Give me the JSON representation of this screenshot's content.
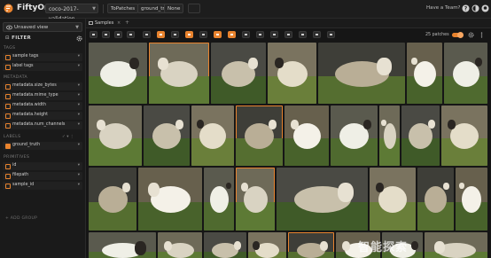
{
  "app": {
    "name": "FiftyOne",
    "dataset": "coco-2017-validation",
    "view_chips": [
      "ToPatches",
      "ground_truth",
      "None"
    ],
    "team_link": "Have a Team?"
  },
  "sidebar": {
    "view_select": "Unsaved view",
    "filter_label": "FILTER",
    "sections": [
      {
        "title": "TAGS",
        "fields": [
          {
            "label": "sample tags",
            "filled": false
          },
          {
            "label": "label tags",
            "filled": false
          }
        ]
      },
      {
        "title": "METADATA",
        "fields": [
          {
            "label": "metadata.size_bytes",
            "filled": false
          },
          {
            "label": "metadata.mime_type",
            "filled": false
          },
          {
            "label": "metadata.width",
            "filled": false
          },
          {
            "label": "metadata.height",
            "filled": false
          },
          {
            "label": "metadata.num_channels",
            "filled": false
          }
        ]
      },
      {
        "title": "LABELS",
        "fields": [
          {
            "label": "ground_truth",
            "filled": true
          }
        ]
      },
      {
        "title": "PRIMITIVES",
        "fields": [
          {
            "label": "id",
            "filled": false
          },
          {
            "label": "filepath",
            "filled": false
          },
          {
            "label": "sample_id",
            "filled": false
          }
        ]
      }
    ],
    "add_group": "+ ADD GROUP"
  },
  "main": {
    "tab_label": "Samples",
    "patches_count": "25 patches"
  },
  "colors": {
    "accent": "#e8832e",
    "background": "#141414",
    "panel": "#1a1a1a"
  },
  "watermark": "智能探索"
}
